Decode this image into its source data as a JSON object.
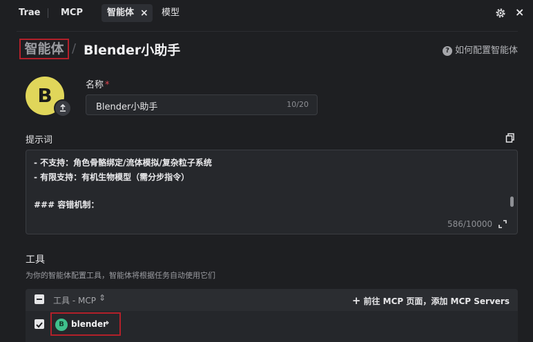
{
  "tabs": {
    "trae": "Trae",
    "mcp": "MCP",
    "agent": "智能体",
    "agent_close": "×",
    "model": "模型"
  },
  "window": {
    "close": "×"
  },
  "breadcrumb": {
    "root": "智能体",
    "separator": "/",
    "title": "Blender小助手"
  },
  "help": {
    "icon": "?",
    "label": "如何配置智能体"
  },
  "avatar": {
    "letter": "B",
    "color": "#e0d65a"
  },
  "name_field": {
    "label": "名称",
    "required_mark": "*",
    "value": "Blender小助手",
    "counter": "10/20"
  },
  "prompt": {
    "label": "提示词",
    "lines": [
      "- 不支持：角色骨骼绑定/流体模拟/复杂粒子系统",
      "- 有限支持：有机生物模型（需分步指令）",
      "### 容错机制："
    ],
    "counter": "586/10000"
  },
  "tools": {
    "title": "工具",
    "description": "为你的智能体配置工具，智能体将根据任务自动使用它们",
    "header_label": "工具 - MCP",
    "header_sort": "⇕",
    "add_plus": "+",
    "add_label": "前往 MCP 页面，添加 MCP Servers",
    "items": [
      {
        "avatar": "B",
        "name": "blender",
        "chevron": "›"
      }
    ]
  },
  "colors": {
    "background": "#1e1f22",
    "highlight_border": "#b3202a",
    "tool_avatar": "#3fc08c"
  }
}
